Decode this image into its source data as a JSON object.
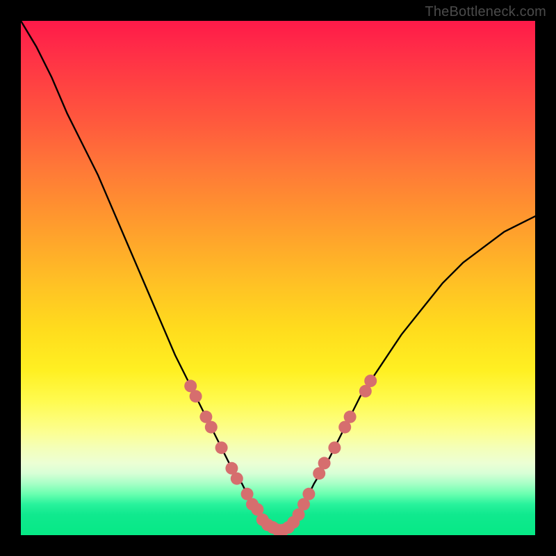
{
  "watermark": "TheBottleneck.com",
  "colors": {
    "frame": "#000000",
    "curve": "#000000",
    "marker": "#d66e6e",
    "gradient_top": "#ff1a49",
    "gradient_bottom": "#06e986"
  },
  "chart_data": {
    "type": "line",
    "title": "",
    "xlabel": "",
    "ylabel": "",
    "xlim": [
      0,
      100
    ],
    "ylim": [
      0,
      100
    ],
    "grid": false,
    "legend": false,
    "note": "Axis values and tick labels are not shown in the source image; x/y are normalized 0–100. Lower y = better (green band). The curve depicts a V-shaped mismatch/bottleneck profile.",
    "series": [
      {
        "name": "bottleneck_curve",
        "x": [
          0,
          3,
          6,
          9,
          12,
          15,
          18,
          21,
          24,
          27,
          30,
          33,
          35,
          37,
          39,
          41,
          43,
          45,
          47,
          49,
          51,
          53,
          55,
          57,
          60,
          63,
          66,
          70,
          74,
          78,
          82,
          86,
          90,
          94,
          98,
          100
        ],
        "y": [
          100,
          95,
          89,
          82,
          76,
          70,
          63,
          56,
          49,
          42,
          35,
          29,
          25,
          21,
          17,
          13,
          10,
          6,
          3,
          1,
          1,
          3,
          6,
          10,
          15,
          21,
          27,
          33,
          39,
          44,
          49,
          53,
          56,
          59,
          61,
          62
        ]
      }
    ],
    "markers": {
      "name": "highlighted_points",
      "note": "Pink bead markers clustered on the lower portions of the V.",
      "marker_color": "#d66e6e",
      "points": [
        {
          "x": 33,
          "y": 29
        },
        {
          "x": 34,
          "y": 27
        },
        {
          "x": 36,
          "y": 23
        },
        {
          "x": 37,
          "y": 21
        },
        {
          "x": 39,
          "y": 17
        },
        {
          "x": 41,
          "y": 13
        },
        {
          "x": 42,
          "y": 11
        },
        {
          "x": 44,
          "y": 8
        },
        {
          "x": 45,
          "y": 6
        },
        {
          "x": 46,
          "y": 5
        },
        {
          "x": 47,
          "y": 3
        },
        {
          "x": 48,
          "y": 2
        },
        {
          "x": 49,
          "y": 1.5
        },
        {
          "x": 50,
          "y": 1
        },
        {
          "x": 51,
          "y": 1
        },
        {
          "x": 52,
          "y": 1.5
        },
        {
          "x": 53,
          "y": 2.5
        },
        {
          "x": 54,
          "y": 4
        },
        {
          "x": 55,
          "y": 6
        },
        {
          "x": 56,
          "y": 8
        },
        {
          "x": 58,
          "y": 12
        },
        {
          "x": 59,
          "y": 14
        },
        {
          "x": 61,
          "y": 17
        },
        {
          "x": 63,
          "y": 21
        },
        {
          "x": 64,
          "y": 23
        },
        {
          "x": 67,
          "y": 28
        },
        {
          "x": 68,
          "y": 30
        }
      ]
    }
  }
}
